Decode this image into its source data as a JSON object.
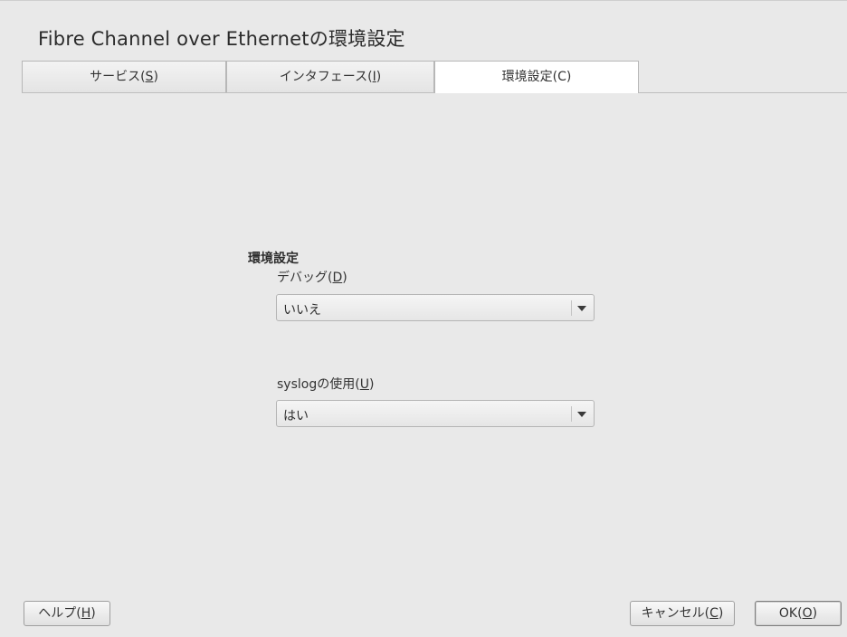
{
  "window": {
    "title": "Fibre Channel over Ethernetの環境設定"
  },
  "tabs": [
    {
      "label": "サービス(",
      "mnemonic": "S",
      "suffix": ")",
      "active": false
    },
    {
      "label": "インタフェース(",
      "mnemonic": "I",
      "suffix": ")",
      "active": false
    },
    {
      "label": "環境設定(C)",
      "mnemonic": "",
      "suffix": "",
      "active": true
    }
  ],
  "form": {
    "section_title": "環境設定",
    "debug": {
      "label_prefix": "デバッグ(",
      "mnemonic": "D",
      "label_suffix": ")",
      "value": "いいえ"
    },
    "syslog": {
      "label_prefix": "syslogの使用(",
      "mnemonic": "U",
      "label_suffix": ")",
      "value": "はい"
    }
  },
  "buttons": {
    "help": {
      "prefix": "ヘルプ(",
      "mnemonic": "H",
      "suffix": ")"
    },
    "cancel": {
      "prefix": "キャンセル(",
      "mnemonic": "C",
      "suffix": ")"
    },
    "ok": {
      "prefix": "OK(",
      "mnemonic": "O",
      "suffix": ")"
    }
  }
}
